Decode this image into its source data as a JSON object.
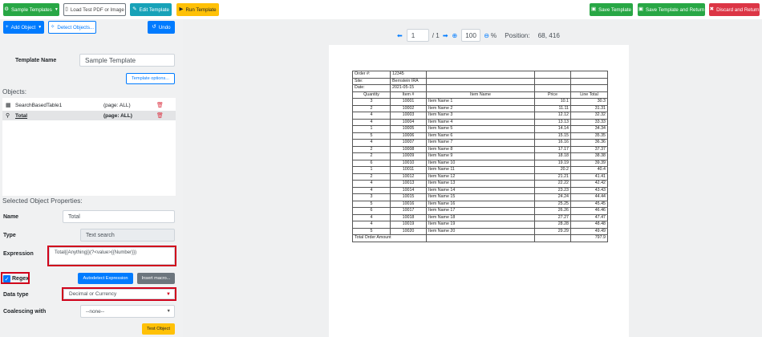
{
  "toolbar": {
    "sample_templates": "Sample Templates",
    "load_pdf": "Load Test PDF or Image",
    "edit_template": "Edit Template",
    "run_template": "Run Template",
    "save_template": "Save Template",
    "save_and_return": "Save Template and Return",
    "discard_and_return": "Discard and Return"
  },
  "left": {
    "add_object": "Add Object",
    "detect_objects": "Detect Objects...",
    "undo": "Undo",
    "template_name_label": "Template Name",
    "template_name_value": "Sample Template",
    "template_options": "Template options...",
    "objects_heading": "Objects:",
    "objects": [
      {
        "name": "SearchBasedTable1",
        "page": "(page: ALL)",
        "icon": "table-icon"
      },
      {
        "name": "Total",
        "page": "(page: ALL)",
        "icon": "search-icon"
      }
    ],
    "props_heading": "Selected Object Properties:",
    "name_label": "Name",
    "name_value": "Total",
    "type_label": "Type",
    "type_value": "Text search",
    "expression_label": "Expression",
    "expression_value": "Total{{Anything}}(?<value>{{Number}})",
    "regex_label": "Regex",
    "autodetect": "Autodetect Expression",
    "insert_macro": "Insert macro...",
    "datatype_label": "Data type",
    "datatype_value": "Decimal or Currency",
    "coalescing_label": "Coalescing with",
    "coalescing_value": "--none--",
    "test_object": "Test Object"
  },
  "viewer": {
    "page_input": "1",
    "page_total": "/ 1",
    "zoom_value": "100",
    "zoom_unit": "%",
    "position_label": "Position:",
    "position_value": "68, 416"
  },
  "pdf": {
    "order_label": "Order #:",
    "order_value": "12345",
    "site_label": "Site:",
    "site_value": "Bernstein IRA",
    "date_label": "Date:",
    "date_value": "2021-05-15",
    "headers": [
      "Quantity",
      "Item #",
      "Item Name",
      "Price",
      "Line Total"
    ],
    "rows": [
      [
        "3",
        "10001",
        "Item Name 1",
        "10.1",
        "30.3"
      ],
      [
        "2",
        "10002",
        "Item Name 2",
        "11.11",
        "31.31"
      ],
      [
        "4",
        "10003",
        "Item Name 3",
        "12.12",
        "32.32"
      ],
      [
        "4",
        "10004",
        "Item Name 4",
        "13.13",
        "33.33"
      ],
      [
        "1",
        "10005",
        "Item Name 5",
        "14.14",
        "34.34"
      ],
      [
        "5",
        "10006",
        "Item Name 6",
        "15.15",
        "35.35"
      ],
      [
        "4",
        "10007",
        "Item Name 7",
        "16.16",
        "36.36"
      ],
      [
        "2",
        "10008",
        "Item Name 8",
        "17.17",
        "37.37"
      ],
      [
        "2",
        "10009",
        "Item Name 9",
        "18.18",
        "38.38"
      ],
      [
        "6",
        "10010",
        "Item Name 10",
        "19.19",
        "39.39"
      ],
      [
        "1",
        "10011",
        "Item Name 11",
        "20.2",
        "40.4"
      ],
      [
        "2",
        "10012",
        "Item Name 12",
        "21.21",
        "41.41"
      ],
      [
        "4",
        "10013",
        "Item Name 13",
        "22.22",
        "42.42"
      ],
      [
        "4",
        "10014",
        "Item Name 14",
        "23.23",
        "43.43"
      ],
      [
        "3",
        "10015",
        "Item Name 15",
        "24.24",
        "44.44"
      ],
      [
        "5",
        "10016",
        "Item Name 16",
        "25.25",
        "45.45"
      ],
      [
        "6",
        "10017",
        "Item Name 17",
        "26.26",
        "46.46"
      ],
      [
        "4",
        "10018",
        "Item Name 18",
        "27.27",
        "47.47"
      ],
      [
        "4",
        "10019",
        "Item Name 19",
        "28.28",
        "48.48"
      ],
      [
        "5",
        "10020",
        "Item Name 20",
        "29.29",
        "49.49"
      ]
    ],
    "total_label": "Total Order Amount",
    "total_value": "797.9"
  },
  "colors": {
    "green": "#28a745",
    "teal": "#17a2b8",
    "yellow": "#ffc107",
    "red": "#dc3545",
    "blue": "#007bff",
    "highlight": "#d0021b"
  }
}
